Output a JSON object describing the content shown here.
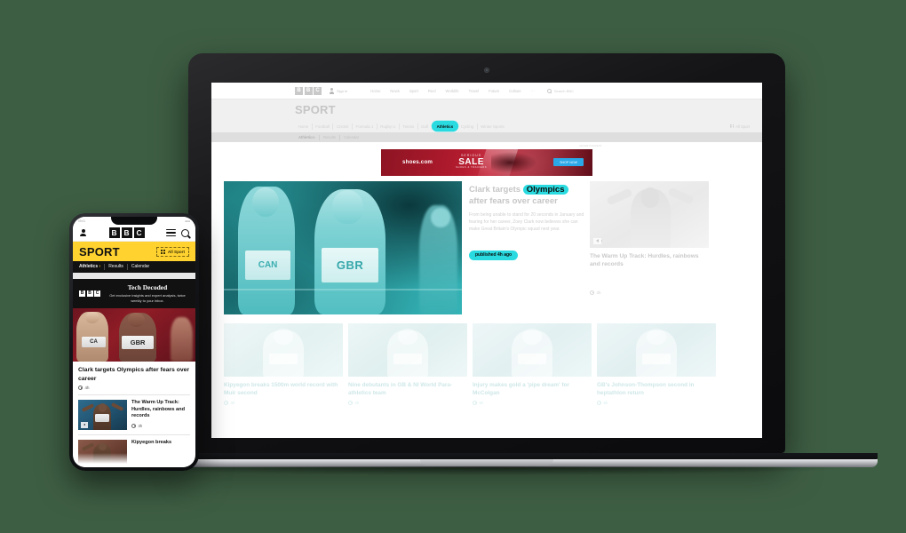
{
  "background": {
    "color": "#3e5e43"
  },
  "accent": {
    "highlight": "#29dbe0",
    "brand_yellow": "#ffd230",
    "ad_red": "#a8192b",
    "ad_cta_blue": "#2aa8e8"
  },
  "laptop": {
    "global_nav": {
      "brand_letters": [
        "B",
        "B",
        "C"
      ],
      "sign_in_label": "Sign in",
      "links": [
        "Home",
        "News",
        "Sport",
        "Reel",
        "Worklife",
        "Travel",
        "Future",
        "Culture"
      ],
      "more_label": "···",
      "search_label": "Search BBC"
    },
    "masthead": {
      "title": "SPORT"
    },
    "sport_nav": {
      "items": [
        {
          "label": "Home",
          "active": false
        },
        {
          "label": "Football",
          "active": false
        },
        {
          "label": "Cricket",
          "active": false
        },
        {
          "label": "Formula 1",
          "active": false
        },
        {
          "label": "Rugby U",
          "active": false
        },
        {
          "label": "Tennis",
          "active": false
        },
        {
          "label": "Golf",
          "active": false
        },
        {
          "label": "Athletics",
          "active": true
        },
        {
          "label": "Cycling",
          "active": false
        },
        {
          "label": "Winter Sports",
          "active": false
        }
      ],
      "all_sport_label": "All Sport"
    },
    "tertiary_nav": {
      "section": "Athletics",
      "chevron": "›",
      "items": [
        "Results",
        "Calendar"
      ]
    },
    "advert": {
      "label": "ADVERTISEMENT",
      "brand": "shoes.com",
      "line1": "SERIOUS",
      "line2": "SALE",
      "line3": "SHOES & TRAINERS",
      "cta": "SHOP NOW"
    },
    "hero": {
      "headline_before": "Clark targets ",
      "headline_mark": "Olympics",
      "headline_after": " after fears over career",
      "summary": "From being unable to stand for 20 seconds in January and fearing for her career, Zoey Clark now believes she can make Great Britain's Olympic squad next year.",
      "published_badge": "published 4h ago",
      "image": {
        "bib_main": "GBR",
        "bib_left": "CAN"
      }
    },
    "side_story": {
      "headline": "The Warm Up Track: Hurdles, rainbows and records",
      "timestamp": "3h",
      "has_audio": true
    },
    "cards": [
      {
        "headline": "Kipyegon breaks 1500m world record with Muir second",
        "timestamp": "4h"
      },
      {
        "headline": "Nine debutants in GB & NI World Para-athletics team",
        "timestamp": "4h"
      },
      {
        "headline": "Injury makes gold a 'pipe dream' for McColgan",
        "timestamp": "5h"
      },
      {
        "headline": "GB's Johnson-Thompson second in heptathlon return",
        "timestamp": "6h"
      }
    ]
  },
  "phone": {
    "status_left": "09:41",
    "status_right": "●●●",
    "brand_letters": [
      "B",
      "B",
      "C"
    ],
    "masthead": {
      "title": "SPORT",
      "all_sport_label": "All Sport"
    },
    "tertiary_nav": {
      "section": "Athletics",
      "chevron": "›",
      "items": [
        "Results",
        "Calendar"
      ]
    },
    "promo": {
      "brand_letters": [
        "B",
        "B",
        "C"
      ],
      "title": "Tech Decoded",
      "subtitle": "Get exclusive insights and expert analysis, twice weekly to your inbox."
    },
    "hero": {
      "headline": "Clark targets Olympics after fears over career",
      "timestamp": "4h",
      "image": {
        "bib_main": "GBR",
        "bib_left": "CA"
      }
    },
    "items": [
      {
        "headline": "The Warm Up Track: Hurdles, rainbows and records",
        "timestamp": "3h",
        "has_audio": true
      },
      {
        "headline": "Kipyegon breaks",
        "timestamp": "",
        "has_audio": false
      }
    ]
  }
}
